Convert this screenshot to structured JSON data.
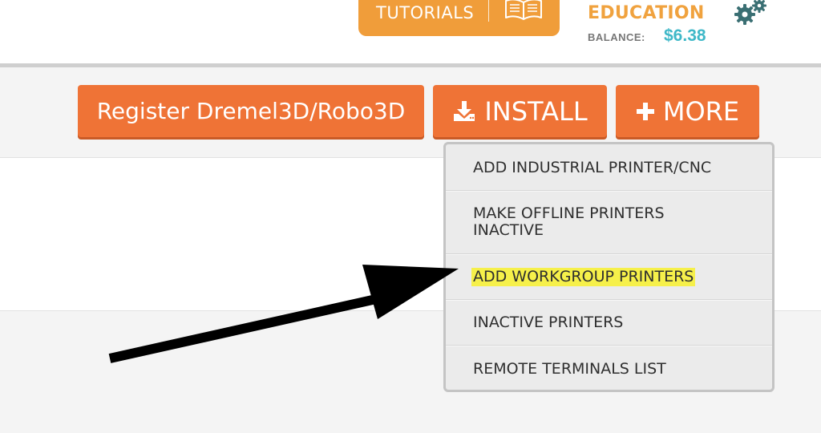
{
  "header": {
    "tutorials_label": "TUTORIALS",
    "account_name": "EDUCATION",
    "balance_label": "BALANCE:",
    "balance_value": "$6.38",
    "icons": [
      "book-icon",
      "gear-icon"
    ]
  },
  "toolbar": {
    "register_label": "Register Dremel3D/Robo3D",
    "install_label": "INSTALL",
    "more_label": "MORE",
    "icons": [
      "download-icon",
      "plus-icon"
    ]
  },
  "more_menu": {
    "items": [
      {
        "line1": "ADD INDUSTRIAL PRINTER/CNC",
        "line2": ""
      },
      {
        "line1": "MAKE OFFLINE PRINTERS",
        "line2": "INACTIVE"
      },
      {
        "line1": "ADD WORKGROUP PRINTERS",
        "line2": ""
      },
      {
        "line1": "INACTIVE PRINTERS",
        "line2": ""
      },
      {
        "line1": "REMOTE TERMINALS LIST",
        "line2": ""
      }
    ],
    "highlighted_index": 2
  },
  "colors": {
    "button_orange": "#ef7336",
    "tutorials_orange": "#f09d3a",
    "account_orange": "#f0a23e",
    "balance_teal": "#3fb8c8",
    "gear_teal": "#3a6f73",
    "highlight_yellow": "#f6f04a",
    "arrow": "#000000"
  }
}
